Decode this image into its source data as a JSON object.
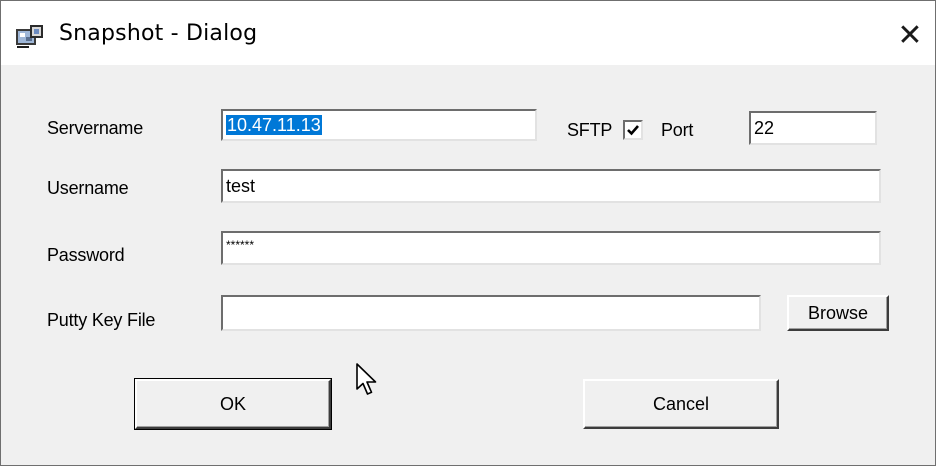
{
  "window": {
    "title": "Snapshot - Dialog",
    "close_glyph": "✕"
  },
  "form": {
    "servername_label": "Servername",
    "servername_value": "10.47.11.13",
    "sftp_label": "SFTP",
    "sftp_checked": true,
    "port_label": "Port",
    "port_value": "22",
    "username_label": "Username",
    "username_value": "test",
    "password_label": "Password",
    "password_value": "******",
    "keyfile_label": "Putty Key File",
    "keyfile_value": "",
    "browse_label": "Browse"
  },
  "buttons": {
    "ok_label": "OK",
    "cancel_label": "Cancel"
  },
  "colors": {
    "selection": "#0078d7",
    "client_bg": "#f0f0f0"
  },
  "icons": {
    "app": "snapshot-app-icon",
    "close": "close-icon",
    "checkmark": "checkmark-icon",
    "cursor": "mouse-pointer-icon"
  }
}
